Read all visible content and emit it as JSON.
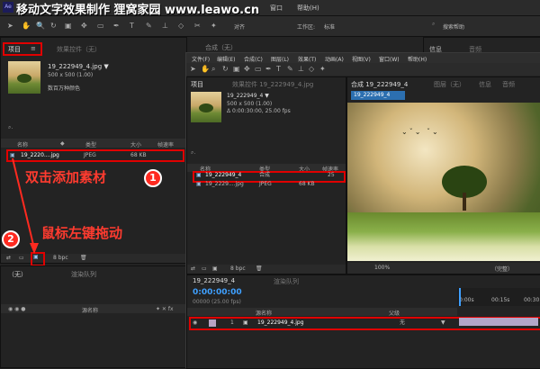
{
  "watermark": {
    "text": "移动文字效果制作 狸窝家园 www.leawo.cn"
  },
  "menu": {
    "items": [
      "文件(F)",
      "编辑(E)",
      "合成(C)",
      "图层(L)",
      "效果(T)",
      "动画(A)",
      "视图(V)",
      "窗口",
      "帮助(H)"
    ]
  },
  "toolbar": {
    "align_label": "对齐",
    "workspace_label": "工作区:",
    "workspace_value": "标准",
    "search_placeholder": "搜索帮助"
  },
  "left_project": {
    "tab_project": "项目",
    "tab_effects": "效果控件（无）",
    "file_name": "19_222949_4.jpg ▼",
    "file_dim": "500 x 500 (1.00)",
    "file_color": "数百万种颜色",
    "col_name": "名称",
    "col_type": "类型",
    "col_size": "大小",
    "col_rate": "帧速率",
    "row_name": "19_2220....jpg",
    "row_type": "JPEG",
    "row_size": "68 KB",
    "bpc": "8 bpc"
  },
  "bottom_left": {
    "tab_none": "（无）",
    "tab_render": "渲染队列",
    "layer_name_col": "源名称"
  },
  "inner_menu": {
    "items": [
      "文件(F)",
      "编辑(E)",
      "合成(C)",
      "图层(L)",
      "效果(T)",
      "动画(A)",
      "视图(V)",
      "窗口(W)",
      "帮助(H)"
    ]
  },
  "inner_project": {
    "tab_project": "项目",
    "tab_effects": "效果控件 19_222949_4.jpg",
    "file_name": "19_222949_4 ▼",
    "file_dim": "500 x 500 (1.00)",
    "file_dur": "Δ 0:00:30:00, 25.00 fps",
    "col_name": "名称",
    "col_type": "类型",
    "col_size": "大小",
    "col_rate": "帧速率",
    "row1_name": "19_222949_4",
    "row1_type": "合成",
    "row1_rate": "25",
    "row2_name": "19_2229....jpg",
    "row2_type": "JPEG",
    "row2_size": "68 KB",
    "bpc": "8 bpc"
  },
  "composition": {
    "tab": "合成 19_222949_4",
    "tab2": "图层（无）",
    "comp_label": "19_222949_4",
    "zoom": "100%",
    "quality": "（完整）"
  },
  "timeline": {
    "tab_comp": "19_222949_4",
    "tab_render": "渲染队列",
    "timecode": "0:00:00:00",
    "frames": "00000 (25.00 fps)",
    "col_source": "源名称",
    "col_parent": "父级",
    "layer_index": "1",
    "layer_name": "19_222949_4.jpg",
    "parent_value": "无",
    "ruler_marks": [
      "0:00s",
      "00:15s",
      "00:30"
    ]
  },
  "top_right": {
    "tab_info": "信息",
    "tab_audio": "音频",
    "tab2_info": "信息",
    "tab2_audio": "音频"
  },
  "annotations": {
    "step1": "双击添加素材",
    "step1_num": "1",
    "step2": "鼠标左键拖动",
    "step2_num": "2"
  },
  "colors": {
    "accent_blue": "#2c6fb0",
    "annotation_red": "#ff2a20",
    "highlight_red": "#e00000"
  }
}
